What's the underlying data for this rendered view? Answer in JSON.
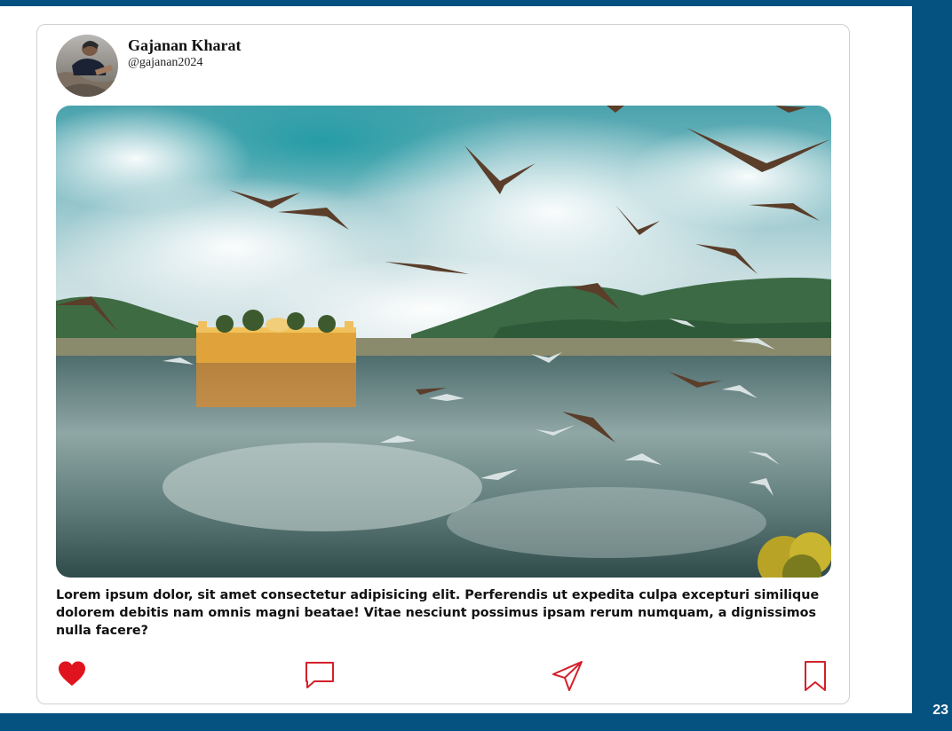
{
  "post": {
    "author": {
      "name": "Gajanan Kharat",
      "handle": "@gajanan2024"
    },
    "caption": "Lorem ipsum dolor, sit amet consectetur adipisicing elit. Perferendis ut expedita culpa excepturi similique dolorem debitis nam omnis magni beatae! Vitae nesciunt possimus ipsam rerum numquam, a dignissimos nulla facere?",
    "actions": {
      "like_icon": "heart-filled-icon",
      "comment_icon": "comment-icon",
      "share_icon": "send-icon",
      "save_icon": "bookmark-icon",
      "liked": true
    }
  },
  "slide_number": "23",
  "colors": {
    "background": "#055180",
    "like": "#e0141e",
    "action_icons": "#d4202a"
  }
}
